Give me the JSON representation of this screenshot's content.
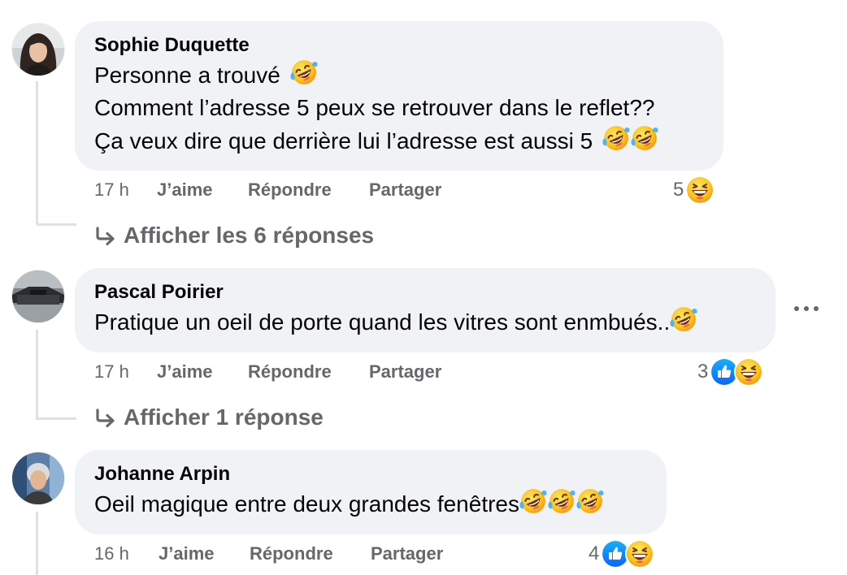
{
  "comments": [
    {
      "author": "Sophie Duquette",
      "lines": [
        "Personne a trouvé",
        "Comment l’adresse 5 peux se retrouver dans le reflet??",
        "Ça veux dire que derrière lui l’adresse est aussi 5"
      ],
      "time": "17 h",
      "like_label": "J’aime",
      "reply_label": "Répondre",
      "share_label": "Partager",
      "reaction_count": "5",
      "reactions": [
        "haha"
      ],
      "replies_label": "Afficher les 6 réponses"
    },
    {
      "author": "Pascal Poirier",
      "lines": [
        "Pratique un oeil de porte quand les vitres sont enmbués.."
      ],
      "time": "17 h",
      "like_label": "J’aime",
      "reply_label": "Répondre",
      "share_label": "Partager",
      "reaction_count": "3",
      "reactions": [
        "like",
        "haha"
      ],
      "replies_label": "Afficher 1 réponse"
    },
    {
      "author": "Johanne Arpin",
      "lines": [
        "Oeil magique entre deux grandes fenêtres"
      ],
      "time": "16 h",
      "like_label": "J’aime",
      "reply_label": "Répondre",
      "share_label": "Partager",
      "reaction_count": "4",
      "reactions": [
        "like",
        "haha"
      ]
    }
  ],
  "icons": {
    "inline_emoji": "rolling-on-floor-laughing-emoji",
    "reaction_like": "like-reaction-icon",
    "reaction_haha": "haha-reaction-icon",
    "reply_arrow": "reply-arrow-icon",
    "more": "more-options-icon"
  },
  "colors": {
    "bubble": "#f0f2f5",
    "secondary_text": "#65676b",
    "like_blue": "#1877f2",
    "haha_yellow": "#f7b928"
  }
}
